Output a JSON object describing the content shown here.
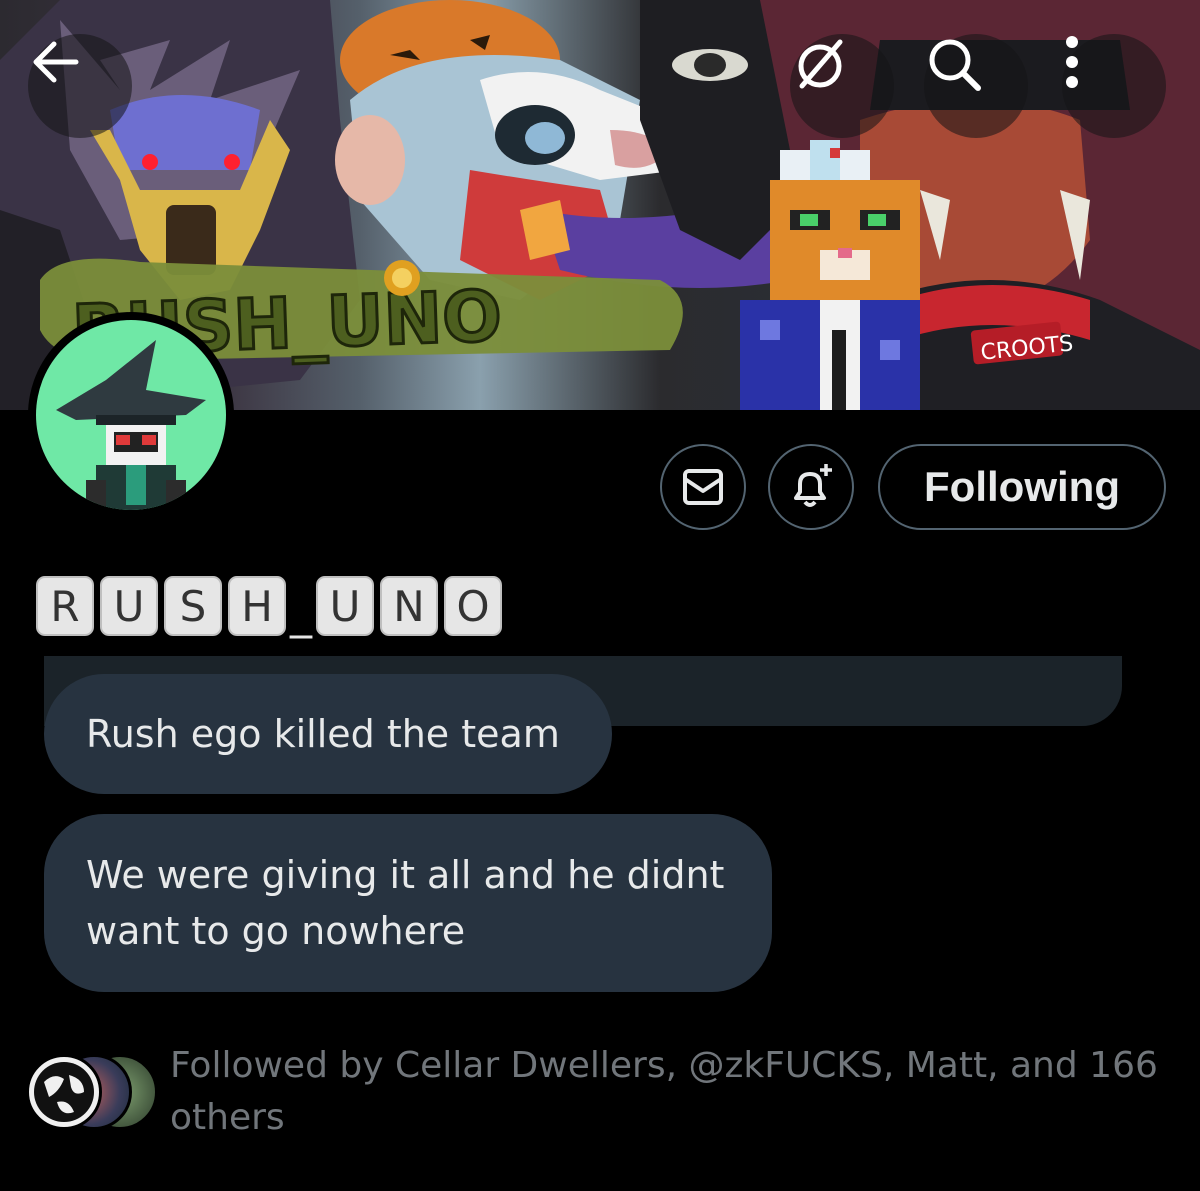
{
  "header": {
    "back_icon": "arrow-left-icon",
    "grok_icon": "slashed-circle-icon",
    "search_icon": "search-icon",
    "more_icon": "vertical-dots-icon"
  },
  "banner": {
    "logo_text": "RUSH_UNO",
    "badge_text": "CROOTS"
  },
  "profile": {
    "name_letters": [
      "R",
      "U",
      "S",
      "H",
      "_",
      "U",
      "N",
      "O"
    ],
    "actions": {
      "message_icon": "envelope-icon",
      "notify_icon": "bell-plus-icon",
      "following_label": "Following"
    },
    "bio": {
      "line1": "Rush ego killed the team",
      "line2": "We were giving it all and he didnt want to go nowhere"
    },
    "followed_by": "Followed by Cellar Dwellers, @zkFUCKS, Matt, and 166 others"
  },
  "colors": {
    "background": "#000000",
    "bubble": "#273340",
    "text_primary": "#e7e9ea",
    "text_secondary": "#71767b",
    "avatar_bg": "#6fe8a6",
    "border": "#536471"
  }
}
